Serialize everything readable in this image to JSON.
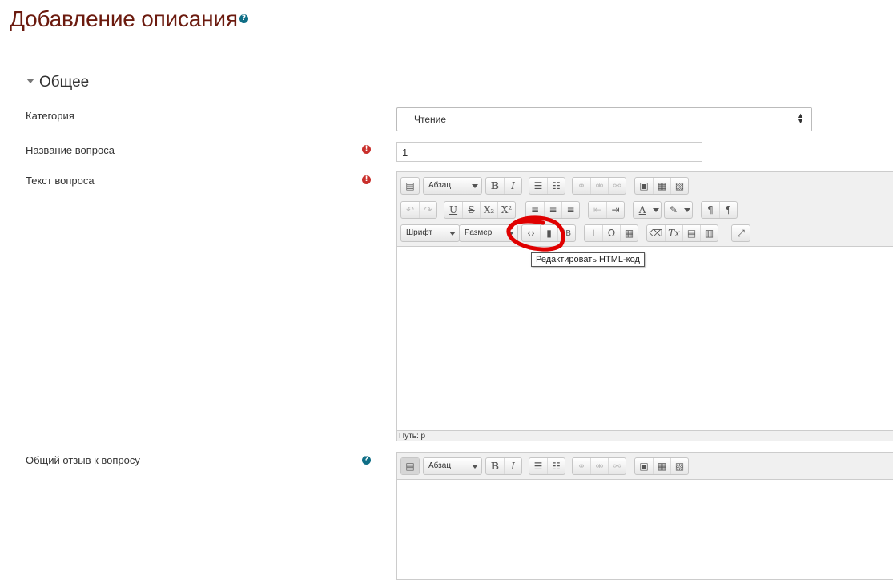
{
  "page": {
    "title": "Добавление описания"
  },
  "section": {
    "title": "Общее"
  },
  "fields": {
    "category": {
      "label": "Категория",
      "value": "Чтение"
    },
    "name": {
      "label": "Название вопроса",
      "value": "1"
    },
    "text": {
      "label": "Текст вопроса"
    },
    "feedback": {
      "label": "Общий отзыв к вопросу"
    }
  },
  "editor": {
    "format_label": "Абзац",
    "font_label": "Шрифт",
    "size_label": "Размер",
    "tooltip": "Редактировать HTML-код",
    "path": "Путь: p"
  },
  "icons": {
    "help": "?",
    "required": "!"
  },
  "colors": {
    "title": "#6b1a0e",
    "help": "#0f6e86",
    "required": "#c9302c",
    "annotation": "#e00000"
  }
}
